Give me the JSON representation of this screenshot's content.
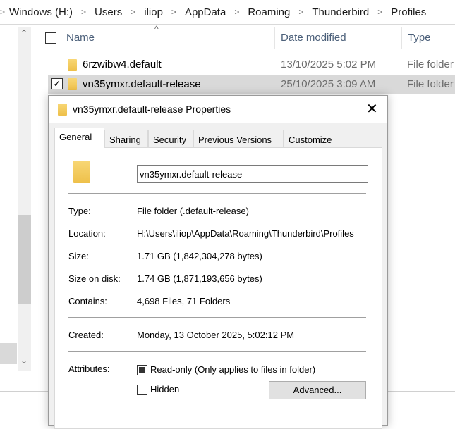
{
  "breadcrumb": [
    "Windows (H:)",
    "Users",
    "iliop",
    "AppData",
    "Roaming",
    "Thunderbird",
    "Profiles"
  ],
  "columns": {
    "name": "Name",
    "date": "Date modified",
    "type": "Type"
  },
  "files": [
    {
      "name": "6rzwibw4.default",
      "date": "13/10/2025 5:02 PM",
      "type": "File folder",
      "selected": false
    },
    {
      "name": "vn35ymxr.default-release",
      "date": "25/10/2025 3:09 AM",
      "type": "File folder",
      "selected": true
    }
  ],
  "dialog": {
    "title": "vn35ymxr.default-release Properties",
    "tabs": [
      "General",
      "Sharing",
      "Security",
      "Previous Versions",
      "Customize"
    ],
    "name_value": "vn35ymxr.default-release",
    "props": [
      {
        "label": "Type:",
        "value": "File folder (.default-release)"
      },
      {
        "label": "Location:",
        "value": "H:\\Users\\iliop\\AppData\\Roaming\\Thunderbird\\Profiles"
      },
      {
        "label": "Size:",
        "value": "1.71 GB (1,842,304,278 bytes)"
      },
      {
        "label": "Size on disk:",
        "value": "1.74 GB (1,871,193,656 bytes)"
      },
      {
        "label": "Contains:",
        "value": "4,698 Files, 71 Folders"
      }
    ],
    "created": {
      "label": "Created:",
      "value": "Monday, 13 October 2025, 5:02:12 PM"
    },
    "attributes": {
      "label": "Attributes:",
      "readonly": "Read-only (Only applies to files in folder)",
      "hidden": "Hidden",
      "advanced": "Advanced..."
    }
  }
}
